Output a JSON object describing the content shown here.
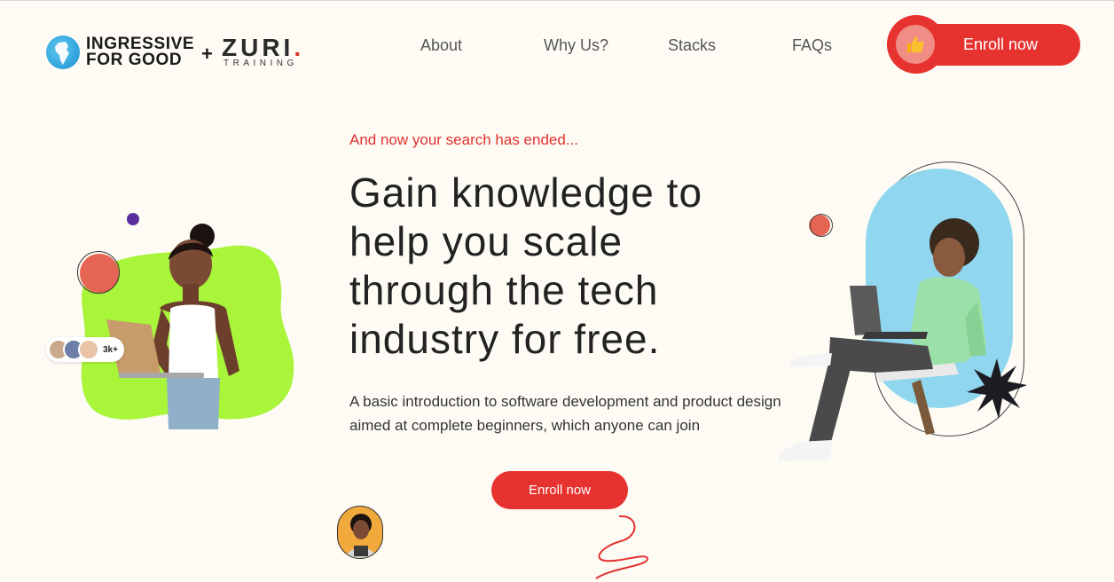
{
  "logo": {
    "ingressive_line1": "INGRESSIVE",
    "ingressive_line2": "FOR GOOD",
    "plus": "+",
    "zuri": "ZURI",
    "zuri_dot": ".",
    "training": "TRAINING"
  },
  "nav": {
    "items": [
      {
        "label": "About"
      },
      {
        "label": "Why Us?"
      },
      {
        "label": "Stacks"
      },
      {
        "label": "FAQs"
      }
    ],
    "enroll_label": "Enroll now",
    "enroll_icon": "thumbs-up-icon"
  },
  "hero": {
    "kicker": "And now your search has ended...",
    "headline": "Gain knowledge to help you scale through the tech industry for free.",
    "description": "A basic introduction to software development and product design aimed at complete beginners, which anyone can join",
    "cta_label": "Enroll now"
  },
  "social_proof": {
    "count": "3k+"
  },
  "colors": {
    "accent": "#e7332f",
    "background": "#fdfbf4",
    "lime": "#a8f53a",
    "sky": "#8fd6ee"
  }
}
